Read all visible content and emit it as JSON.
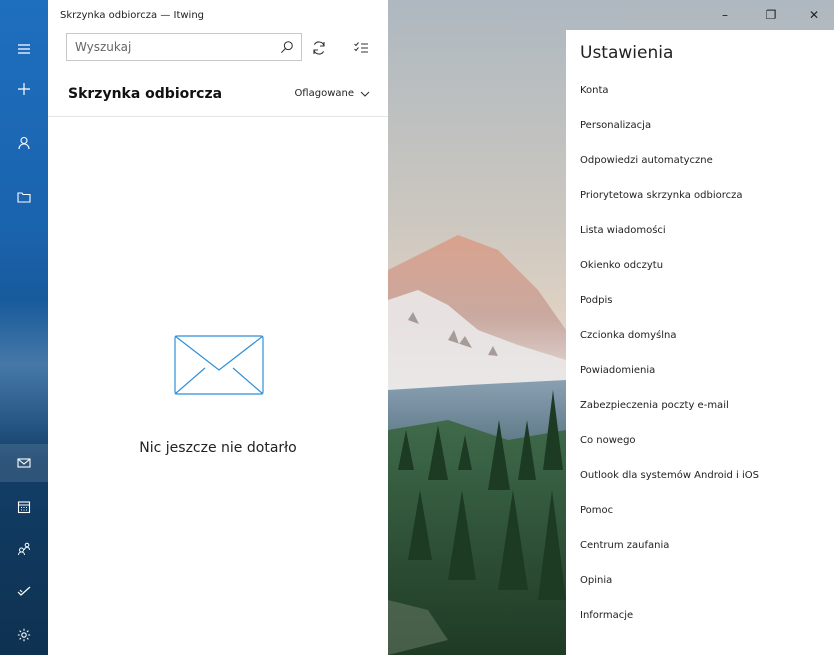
{
  "window": {
    "title": "Skrzynka odbiorcza — Itwing",
    "controls": {
      "minimize": "–",
      "restore": "❐",
      "close": "✕"
    }
  },
  "nav_rail": {
    "items": [
      {
        "id": "menu",
        "icon": "hamburger-icon"
      },
      {
        "id": "new-mail",
        "icon": "plus-icon"
      },
      {
        "id": "accounts",
        "icon": "person-icon"
      },
      {
        "id": "folders",
        "icon": "folder-icon"
      },
      {
        "id": "mail",
        "icon": "mail-icon"
      },
      {
        "id": "calendar",
        "icon": "calendar-icon"
      },
      {
        "id": "people",
        "icon": "people-icon"
      },
      {
        "id": "todo",
        "icon": "check-icon"
      },
      {
        "id": "settings",
        "icon": "gear-icon"
      }
    ]
  },
  "mail_list": {
    "search_placeholder": "Wyszukaj",
    "folder_title": "Skrzynka odbiorcza",
    "filter_label": "Oflagowane",
    "empty_message": "Nic jeszcze nie dotarło"
  },
  "settings": {
    "title": "Ustawienia",
    "items": [
      "Konta",
      "Personalizacja",
      "Odpowiedzi automatyczne",
      "Priorytetowa skrzynka odbiorcza",
      "Lista wiadomości",
      "Okienko odczytu",
      "Podpis",
      "Czcionka domyślna",
      "Powiadomienia",
      "Zabezpieczenia poczty e-mail",
      "Co nowego",
      "Outlook dla systemów Android i iOS",
      "Pomoc",
      "Centrum zaufania",
      "Opinia",
      "Informacje"
    ]
  },
  "colors": {
    "rail_blue": "#1e6fbf",
    "envelope_stroke": "#2f8fd8"
  }
}
